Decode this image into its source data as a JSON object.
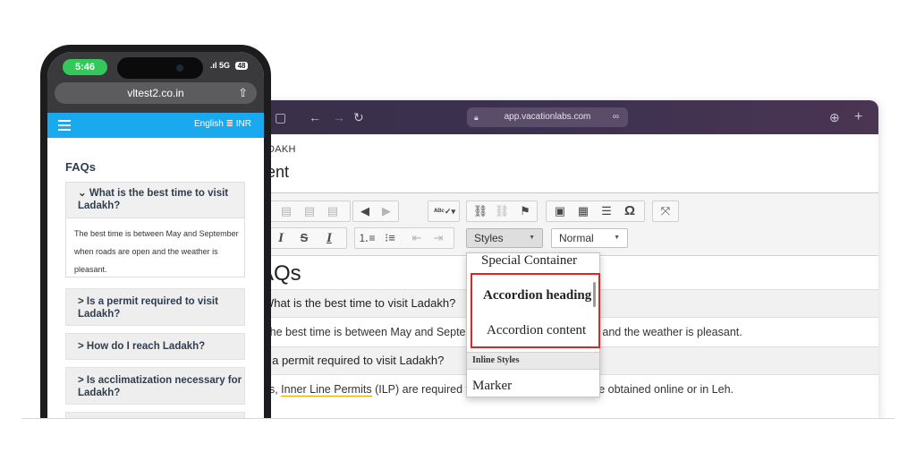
{
  "browser": {
    "url": "app.vacationlabs.com",
    "breadcrumb": "DAKH",
    "field_label": "tent"
  },
  "toolbar": {
    "styles_label": "Styles",
    "format_label": "Normal"
  },
  "editor": {
    "heading": "AQs",
    "rows": [
      "What is the best time to visit Ladakh?",
      "The best time is between May and September when roads are open and the weather is pleasant.",
      "s a permit required to visit Ladakh?"
    ],
    "row4": {
      "prefix": "es, ",
      "link": "Inner Line Permits",
      "suffix": " (ILP) are required for certain areas and can be obtained online or in Leh."
    }
  },
  "dropdown": {
    "items": [
      "Special Container",
      "Accordion heading",
      "Accordion content"
    ],
    "section_label": "Inline Styles",
    "inline_items": [
      "Marker"
    ]
  },
  "phone": {
    "time": "5:46",
    "network": "5G",
    "battery": "48",
    "address": "vltest2.co.in",
    "language": "English",
    "currency": "INR",
    "faq_title": "FAQs",
    "open_question": "What is the best time to visit Ladakh?",
    "open_answer": "The best time is between May and September when roads are open and the weather is pleasant.",
    "questions": [
      "Is a permit required to visit Ladakh?",
      "How do I reach Ladakh?",
      "Is acclimatization necessary for Ladakh?"
    ]
  },
  "colors": {
    "highlight": "#e02424",
    "nav": "#19a9ef",
    "time_pill": "#34c759"
  }
}
